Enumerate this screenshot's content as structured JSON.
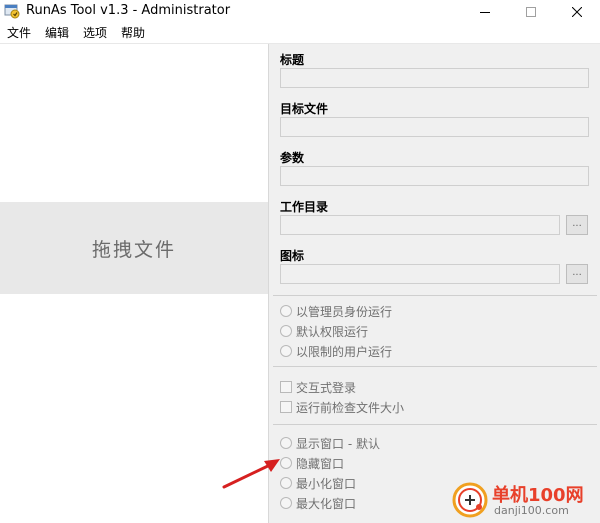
{
  "window": {
    "title": "RunAs Tool v1.3 - Administrator"
  },
  "menu": {
    "items": [
      {
        "label": "文件"
      },
      {
        "label": "编辑"
      },
      {
        "label": "选项"
      },
      {
        "label": "帮助"
      }
    ]
  },
  "drop_zone": {
    "label": "拖拽文件"
  },
  "fields": {
    "title": {
      "label": "标题",
      "value": ""
    },
    "target": {
      "label": "目标文件",
      "value": ""
    },
    "params": {
      "label": "参数",
      "value": ""
    },
    "workdir": {
      "label": "工作目录",
      "value": "",
      "browse": "..."
    },
    "icon": {
      "label": "图标",
      "value": "",
      "browse": "..."
    }
  },
  "run_mode": {
    "options": [
      {
        "label": "以管理员身份运行"
      },
      {
        "label": "默认权限运行"
      },
      {
        "label": "以限制的用户运行"
      }
    ]
  },
  "checks": {
    "options": [
      {
        "label": "交互式登录"
      },
      {
        "label": "运行前检查文件大小"
      }
    ]
  },
  "window_mode": {
    "options": [
      {
        "label": "显示窗口 - 默认"
      },
      {
        "label": "隐藏窗口"
      },
      {
        "label": "最小化窗口"
      },
      {
        "label": "最大化窗口"
      }
    ]
  },
  "watermark": {
    "name": "单机100网",
    "url": "danji100.com"
  },
  "colors": {
    "accent": "#e8402a",
    "panel": "#f0f0f0",
    "drop_zone": "#e8e8e8"
  }
}
